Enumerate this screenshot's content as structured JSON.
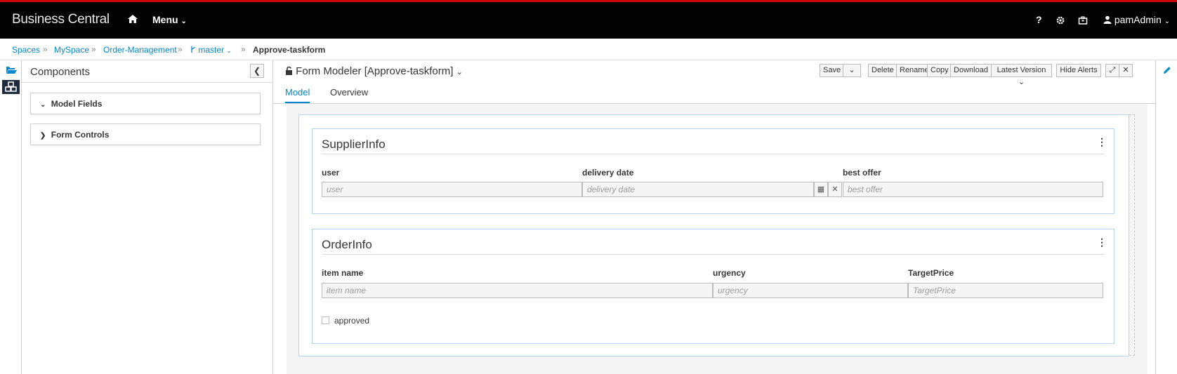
{
  "header": {
    "brand": "Business Central",
    "menu_label": "Menu",
    "help_label": "?",
    "user": "pamAdmin",
    "icons": [
      "home-icon",
      "gear-icon",
      "briefcase-icon",
      "user-icon"
    ]
  },
  "breadcrumb": {
    "items": [
      "Spaces",
      "MySpace",
      "Order-Management"
    ],
    "branch": "master",
    "current": "Approve-taskform",
    "separator": "»"
  },
  "components": {
    "title": "Components",
    "sections": [
      "Model Fields",
      "Form Controls"
    ]
  },
  "editor": {
    "title": "Form Modeler [Approve-taskform]",
    "toolbar": {
      "save": "Save",
      "delete": "Delete",
      "rename": "Rename",
      "copy": "Copy",
      "download": "Download",
      "latest_version": "Latest Version",
      "hide_alerts": "Hide Alerts"
    },
    "tabs": [
      "Model",
      "Overview"
    ],
    "active_tab": "Model"
  },
  "form": {
    "supplier": {
      "title": "SupplierInfo",
      "fields": [
        {
          "label": "user",
          "placeholder": "user"
        },
        {
          "label": "delivery date",
          "placeholder": "delivery date"
        },
        {
          "label": "best offer",
          "placeholder": "best offer"
        }
      ]
    },
    "order": {
      "title": "OrderInfo",
      "fields": [
        {
          "label": "item name",
          "placeholder": "item name"
        },
        {
          "label": "urgency",
          "placeholder": "urgency"
        },
        {
          "label": "TargetPrice",
          "placeholder": "TargetPrice"
        }
      ],
      "checkbox_label": "approved"
    }
  },
  "colors": {
    "accent": "#0088ce",
    "navbar": "#030303",
    "top_stripe": "#cc0000"
  }
}
